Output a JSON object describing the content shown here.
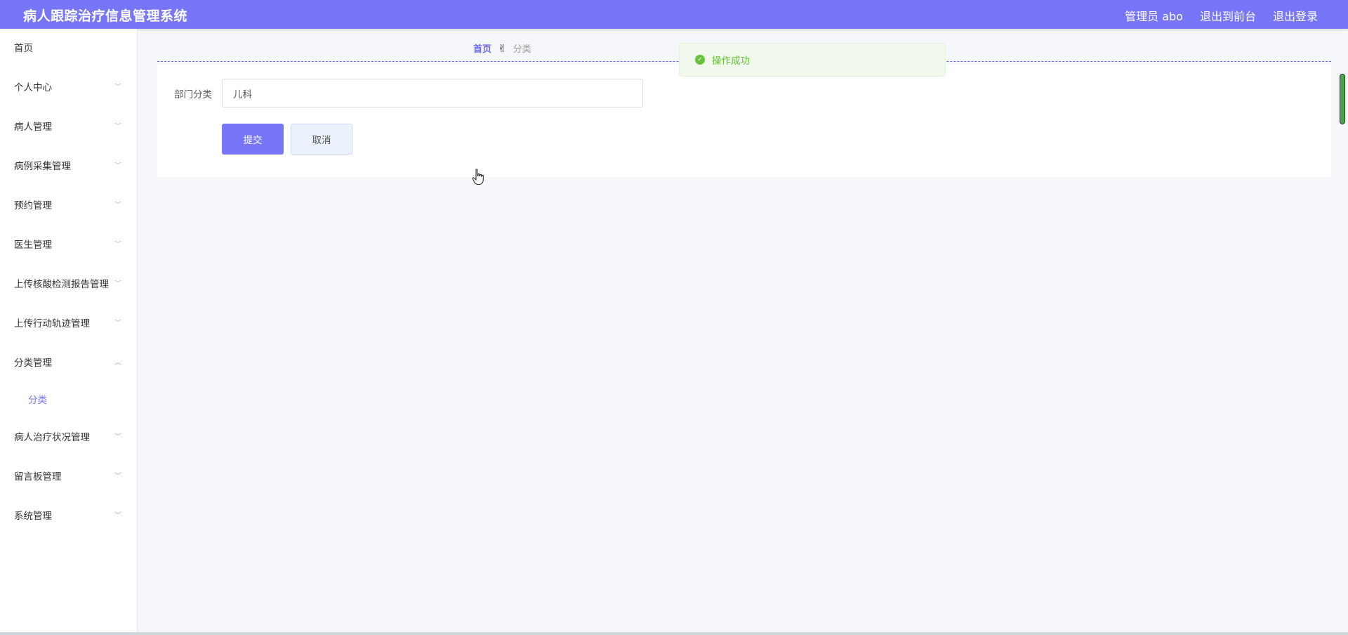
{
  "header": {
    "app_title": "病人跟踪治疗信息管理系统",
    "user_label": "管理员 abo",
    "to_frontend_label": "退出到前台",
    "logout_label": "退出登录"
  },
  "sidebar": {
    "items": [
      {
        "label": "首页",
        "has_chevron": false
      },
      {
        "label": "个人中心",
        "has_chevron": true
      },
      {
        "label": "病人管理",
        "has_chevron": true
      },
      {
        "label": "病例采集管理",
        "has_chevron": true
      },
      {
        "label": "预约管理",
        "has_chevron": true
      },
      {
        "label": "医生管理",
        "has_chevron": true
      },
      {
        "label": "上传核酸检测报告管理",
        "has_chevron": true
      },
      {
        "label": "上传行动轨迹管理",
        "has_chevron": true
      },
      {
        "label": "分类管理",
        "has_chevron": true,
        "expanded": true
      },
      {
        "label": "病人治疗状况管理",
        "has_chevron": true
      },
      {
        "label": "留言板管理",
        "has_chevron": true
      },
      {
        "label": "系统管理",
        "has_chevron": true
      }
    ],
    "submenu": {
      "label": "分类",
      "parent": "分类管理"
    }
  },
  "breadcrumb": {
    "home": "首页",
    "separator": "✌",
    "current": "分类"
  },
  "form": {
    "department_label": "部门分类",
    "department_value": "儿科",
    "submit_label": "提交",
    "cancel_label": "取消"
  },
  "toast": {
    "message": "操作成功",
    "type": "success"
  },
  "colors": {
    "primary": "#7775f8",
    "success": "#67c23a"
  }
}
